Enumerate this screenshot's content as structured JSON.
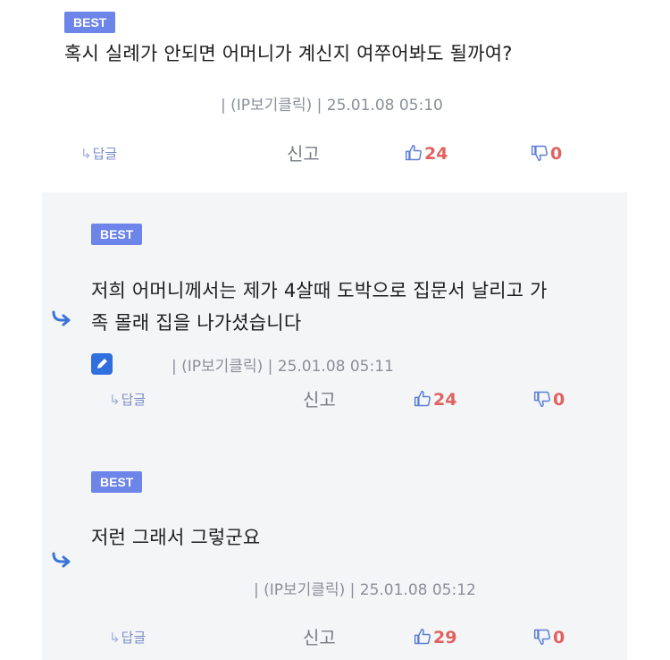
{
  "comments": [
    {
      "badge": "BEST",
      "text_lines": [
        "혹시 실례가 안되면 어머니가 계신지 여쭈어봐도 될까여?"
      ],
      "meta": "| (IP보기클릭) | 25.01.08 05:10",
      "reply_label": "답글",
      "report_label": "신고",
      "up_count": "24",
      "down_count": "0"
    },
    {
      "badge": "BEST",
      "text_lines": [
        "저희 어머니께서는 제가 4살때 도박으로 집문서 날리고  가",
        "족 몰래 집을 나가셨습니다"
      ],
      "meta": "| (IP보기클릭) | 25.01.08 05:11",
      "reply_label": "답글",
      "report_label": "신고",
      "up_count": "24",
      "down_count": "0"
    },
    {
      "badge": "BEST",
      "text_lines": [
        "저런 그래서 그렇군요"
      ],
      "meta": "| (IP보기클릭) | 25.01.08 05:12",
      "reply_label": "답글",
      "report_label": "신고",
      "up_count": "29",
      "down_count": "0"
    }
  ],
  "icons": {
    "reply": "reply-arrow-icon",
    "thumbs_up": "thumbs-up-icon",
    "thumbs_down": "thumbs-down-icon",
    "nested_reply": "nested-reply-arrow-icon",
    "edit": "pencil-icon"
  },
  "colors": {
    "badge": "#6d84e8",
    "vote_count": "#e0625f",
    "thumb_icon": "#5c7fd6",
    "nested_bg": "#f4f5f7",
    "reply_arrow": "#3a74d8"
  }
}
